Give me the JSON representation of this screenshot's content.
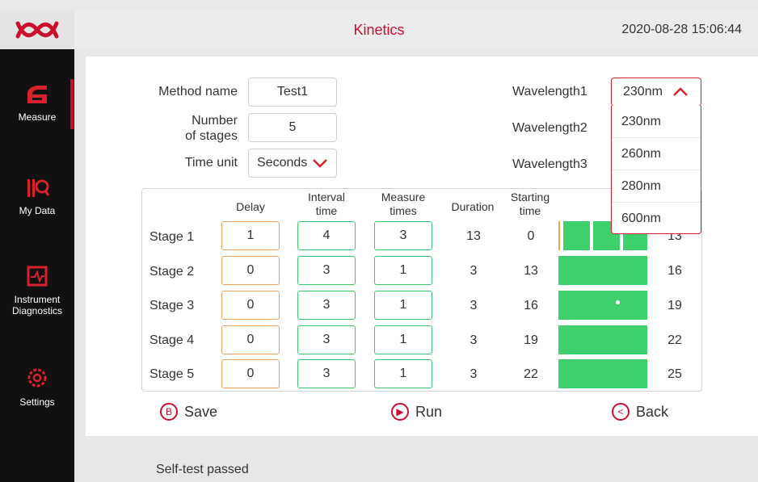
{
  "header": {
    "title": "Kinetics",
    "datetime": "2020-08-28 15:06:44"
  },
  "sidebar": {
    "items": [
      {
        "label": "Measure",
        "icon": "measure-icon"
      },
      {
        "label": "My Data",
        "icon": "my-data-icon"
      },
      {
        "label": "Instrument\nDiagnostics",
        "icon": "diagnostics-icon"
      },
      {
        "label": "Settings",
        "icon": "settings-icon"
      }
    ]
  },
  "form": {
    "method_name_label": "Method name",
    "method_name_value": "Test1",
    "stages_label_line1": "Number",
    "stages_label_line2": "of stages",
    "stages_value": "5",
    "time_unit_label": "Time unit",
    "time_unit_value": "Seconds",
    "wavelength1_label": "Wavelength1",
    "wavelength1_value": "230nm",
    "wavelength2_label": "Wavelength2",
    "wavelength3_label": "Wavelength3",
    "wavelength_options": [
      "230nm",
      "260nm",
      "280nm",
      "600nm"
    ]
  },
  "table": {
    "headers": {
      "delay": "Delay",
      "interval": "Interval\ntime",
      "measure": "Measure\ntimes",
      "duration": "Duration",
      "start": "Starting\ntime"
    },
    "rows": [
      {
        "stage": "Stage 1",
        "delay": "1",
        "interval": "4",
        "measure": "3",
        "duration": "13",
        "start": "0",
        "end": "13"
      },
      {
        "stage": "Stage 2",
        "delay": "0",
        "interval": "3",
        "measure": "1",
        "duration": "3",
        "start": "13",
        "end": "16"
      },
      {
        "stage": "Stage 3",
        "delay": "0",
        "interval": "3",
        "measure": "1",
        "duration": "3",
        "start": "16",
        "end": "19"
      },
      {
        "stage": "Stage 4",
        "delay": "0",
        "interval": "3",
        "measure": "1",
        "duration": "3",
        "start": "19",
        "end": "22"
      },
      {
        "stage": "Stage 5",
        "delay": "0",
        "interval": "3",
        "measure": "1",
        "duration": "3",
        "start": "22",
        "end": "25"
      }
    ]
  },
  "actions": {
    "save": "Save",
    "run": "Run",
    "back": "Back"
  },
  "status": {
    "text": "Self-test passed"
  },
  "colors": {
    "accent": "#c8102e",
    "bar": "#3dd06c",
    "delay_border": "#f0a15a",
    "interval_border": "#3ec46d"
  }
}
